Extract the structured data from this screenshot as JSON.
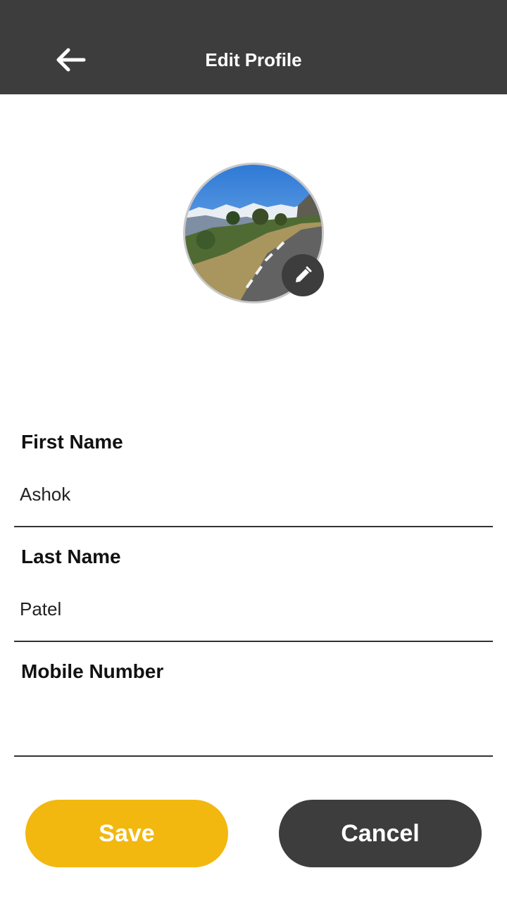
{
  "header": {
    "title": "Edit Profile",
    "back_icon": "arrow-left-icon"
  },
  "avatar": {
    "edit_icon": "pencil-icon"
  },
  "form": {
    "first_name": {
      "label": "First Name",
      "value": "Ashok",
      "placeholder": ""
    },
    "last_name": {
      "label": "Last Name",
      "value": "Patel",
      "placeholder": ""
    },
    "mobile_number": {
      "label": "Mobile Number",
      "value": "",
      "placeholder": ""
    }
  },
  "actions": {
    "save_label": "Save",
    "cancel_label": "Cancel"
  },
  "colors": {
    "app_bar": "#3d3d3d",
    "save_button": "#f2b80f",
    "cancel_button": "#3d3d3d"
  }
}
